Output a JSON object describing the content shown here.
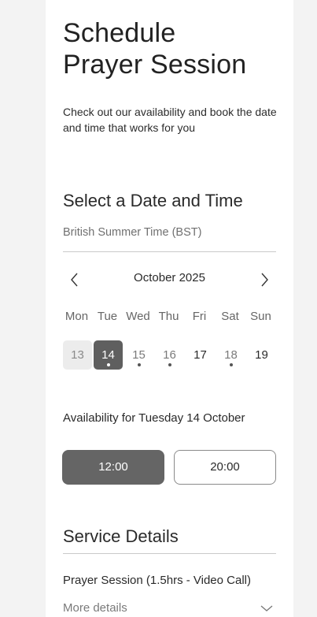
{
  "header": {
    "title_line1": "Schedule",
    "title_line2": "Prayer Session",
    "subtitle": "Check out our availability and book the date and time that works for you"
  },
  "booking": {
    "heading": "Select a Date and Time",
    "timezone": "British Summer Time (BST)",
    "month_label": "October 2025",
    "prev_icon": "chevron-left-icon",
    "next_icon": "chevron-right-icon",
    "weekdays": [
      "Mon",
      "Tue",
      "Wed",
      "Thu",
      "Fri",
      "Sat",
      "Sun"
    ],
    "days": [
      {
        "label": "13",
        "state": "past",
        "dot": false
      },
      {
        "label": "14",
        "state": "selected",
        "dot": true
      },
      {
        "label": "15",
        "state": "available",
        "dot": true
      },
      {
        "label": "16",
        "state": "available",
        "dot": true
      },
      {
        "label": "17",
        "state": "plain",
        "dot": false
      },
      {
        "label": "18",
        "state": "available",
        "dot": true
      },
      {
        "label": "19",
        "state": "plain",
        "dot": false
      }
    ],
    "availability_label": "Availability for Tuesday 14 October",
    "slots": [
      {
        "label": "12:00",
        "selected": true
      },
      {
        "label": "20:00",
        "selected": false
      }
    ]
  },
  "service": {
    "heading": "Service Details",
    "name": "Prayer Session (1.5hrs - Video Call)",
    "more_label": "More details",
    "more_icon": "chevron-down-icon"
  },
  "colors": {
    "background": "#f3f3f3",
    "panel": "#ffffff",
    "selected": "#5f5f5f",
    "past_day_bg": "#ececec",
    "muted_text": "#7a7a7a"
  }
}
